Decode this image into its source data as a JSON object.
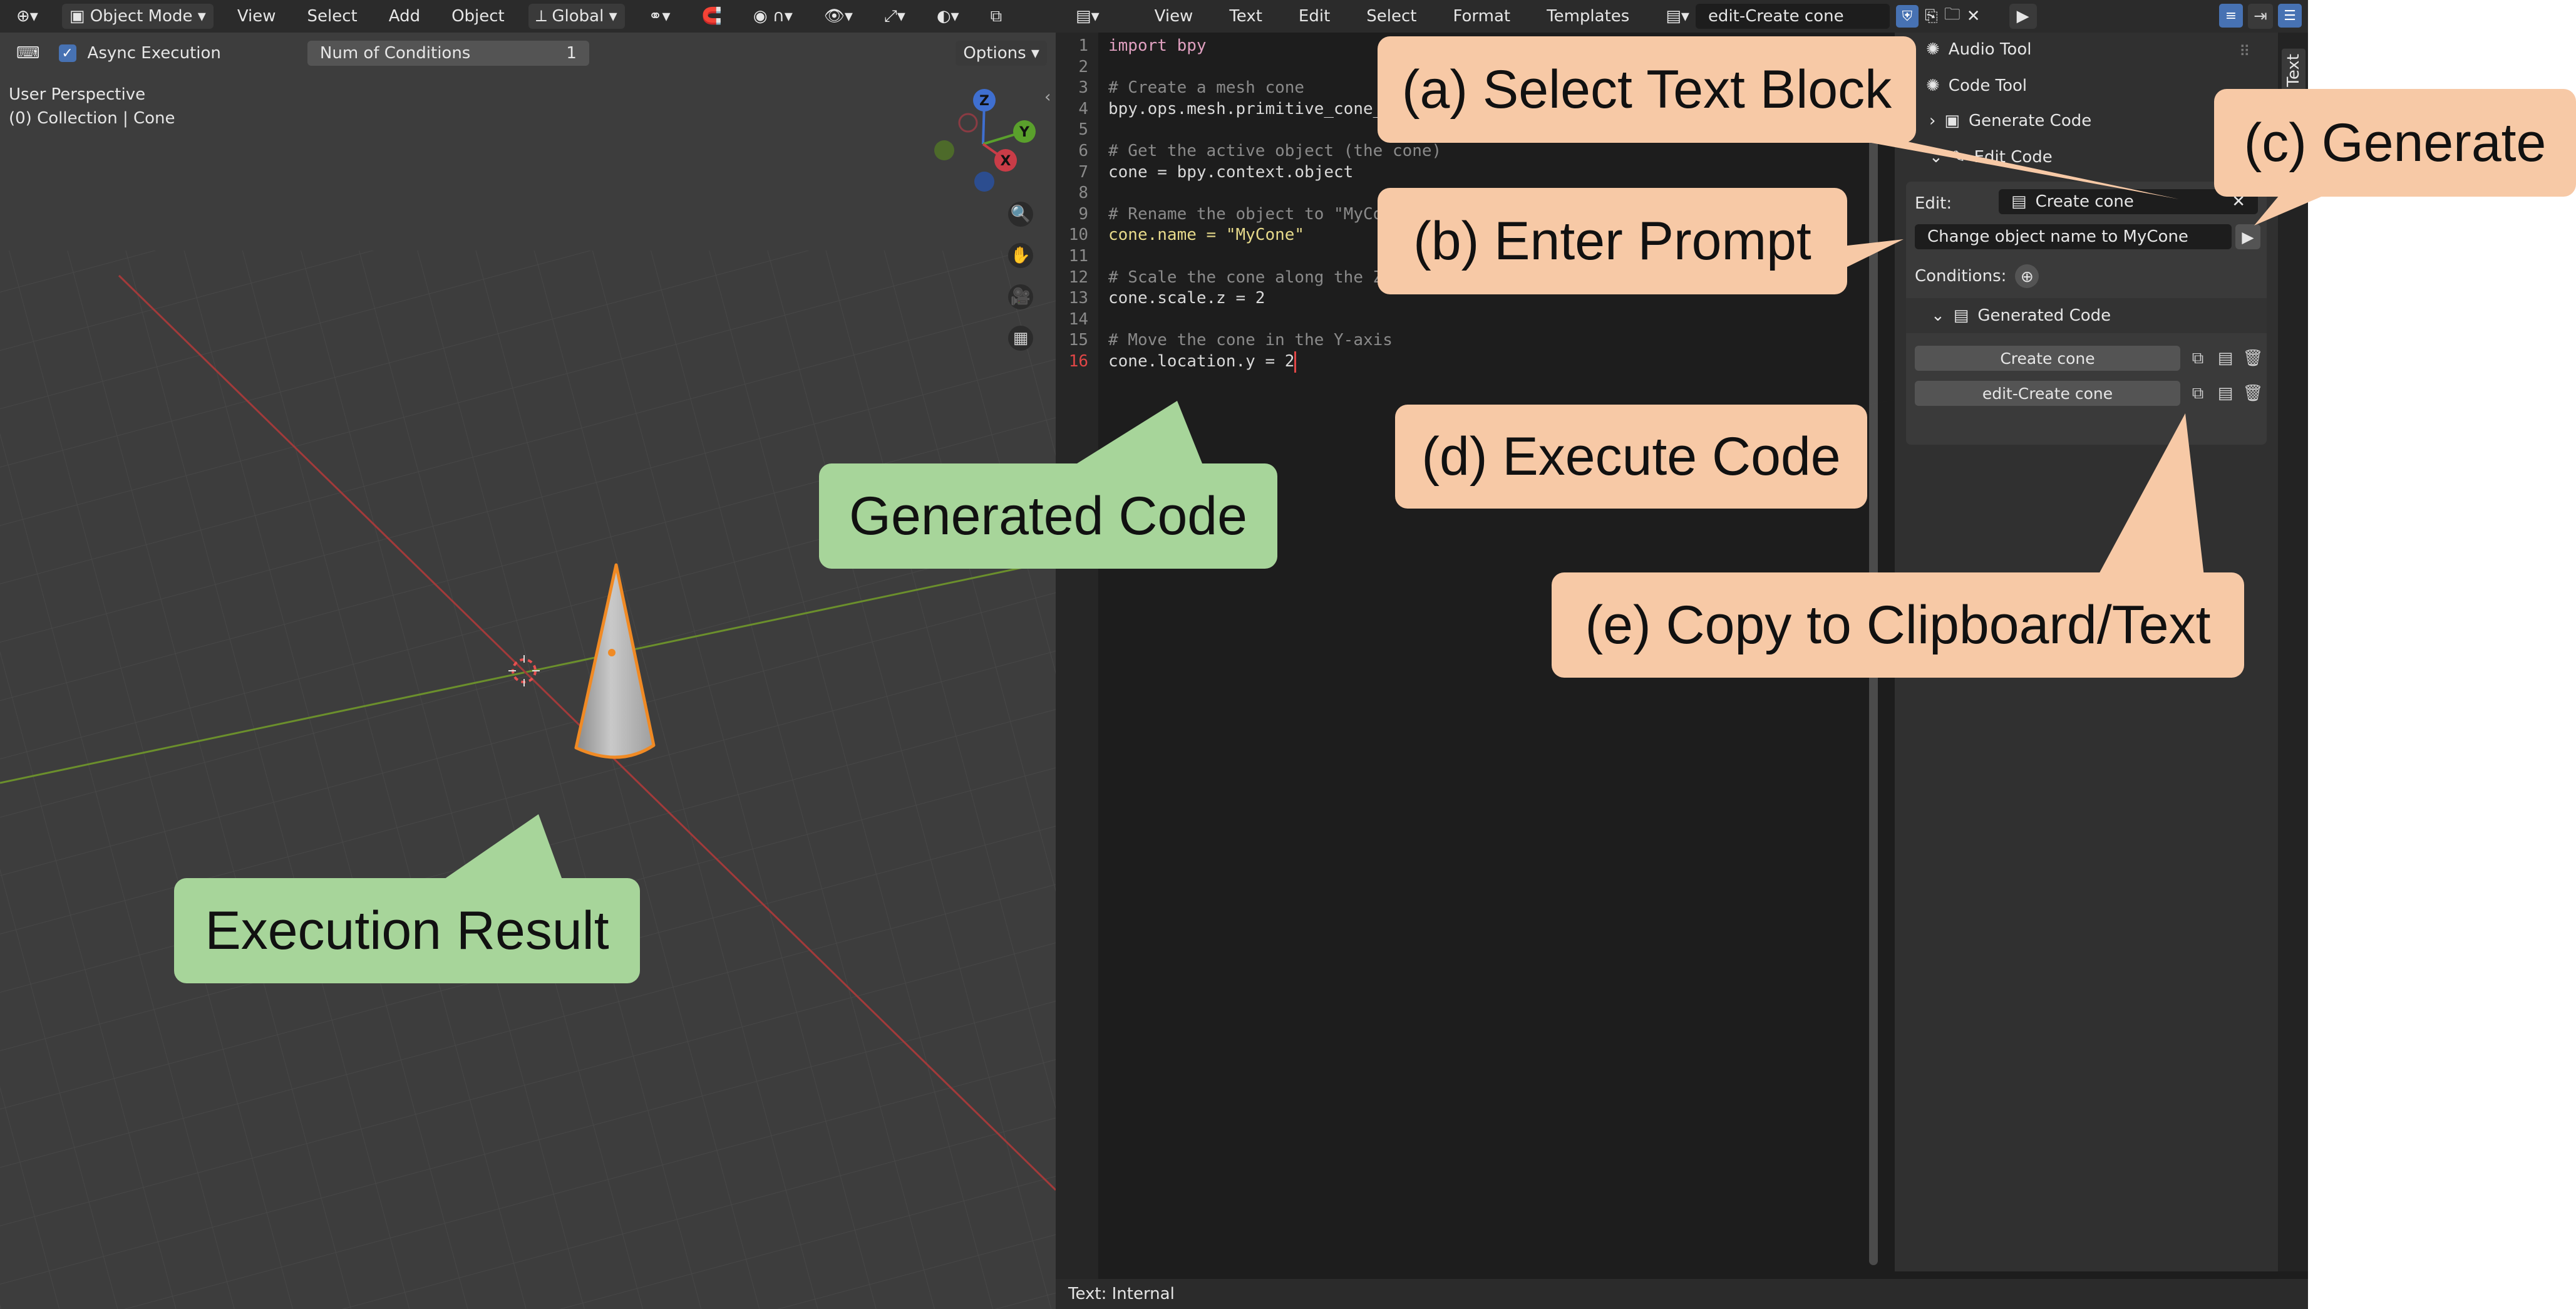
{
  "viewport": {
    "header": {
      "mode": "Object Mode",
      "menus": [
        "View",
        "Select",
        "Add",
        "Object"
      ],
      "orientation": "Global"
    },
    "subheader": {
      "async_label": "Async Execution",
      "conditions_label": "Num of Conditions",
      "conditions_value": "1",
      "options_label": "Options"
    },
    "overlay": {
      "perspective": "User Perspective",
      "collection": "(0) Collection | Cone"
    },
    "gizmo": {
      "x": "X",
      "y": "Y",
      "z": "Z"
    }
  },
  "editor": {
    "menus": [
      "View",
      "Text",
      "Edit",
      "Select",
      "Format",
      "Templates"
    ],
    "text_name": "edit-Create cone",
    "footer": "Text: Internal",
    "line_numbers": [
      "1",
      "2",
      "3",
      "4",
      "5",
      "6",
      "7",
      "8",
      "9",
      "10",
      "11",
      "12",
      "13",
      "14",
      "15",
      "16"
    ],
    "code": [
      "import bpy",
      "",
      "# Create a mesh cone",
      "bpy.ops.mesh.primitive_cone_",
      "",
      "# Get the active object (the cone)",
      "cone = bpy.context.object",
      "",
      "# Rename the object to \"MyCo",
      "cone.name = \"MyCone\"",
      "",
      "# Scale the cone along the Z",
      "cone.scale.z = 2",
      "",
      "# Move the cone in the Y-axis",
      "cone.location.y = 2"
    ]
  },
  "sidebar": {
    "tab_label": "Text",
    "audio_tool": "Audio Tool",
    "code_tool": "Code Tool",
    "generate_code": "Generate Code",
    "edit_code": "Edit Code",
    "edit_label": "Edit:",
    "edit_value": "Create cone",
    "prompt_value": "Change object name to MyCone",
    "conditions_label": "Conditions:",
    "generated_header": "Generated Code",
    "items": [
      "Create cone",
      "edit-Create cone"
    ]
  },
  "callouts": {
    "a": "(a) Select Text Block",
    "b": "(b) Enter Prompt",
    "c": "(c) Generate",
    "d": "(d) Execute Code",
    "e": "(e) Copy to Clipboard/Text",
    "generated": "Generated Code",
    "execution": "Execution Result"
  },
  "colors": {
    "accent": "#4772b3",
    "callout_orange": "#f7c9a6",
    "callout_green": "#a7d59a",
    "cone_outline": "#f08a24"
  }
}
